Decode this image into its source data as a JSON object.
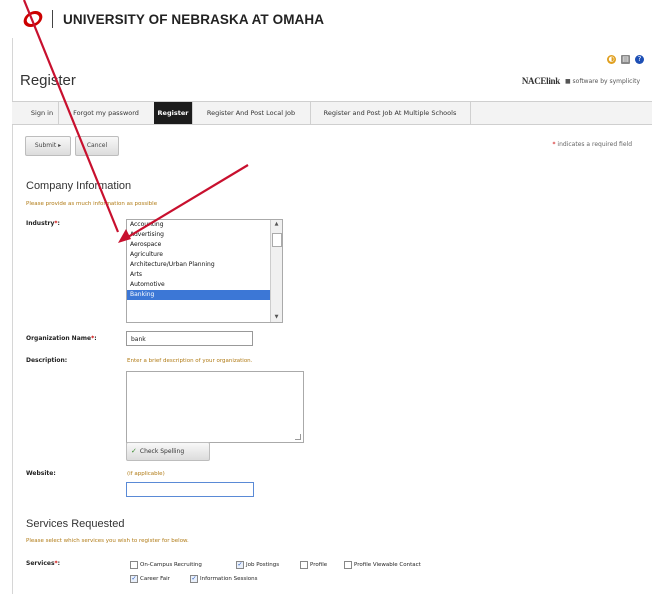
{
  "banner": {
    "university": "UNIVERSITY OF NEBRASKA AT OMAHA"
  },
  "header": {
    "title": "Register",
    "brand_nace": "NACElink",
    "brand_symplicity": "software by symplicity"
  },
  "tabs": [
    {
      "label": "Sign in",
      "active": false
    },
    {
      "label": "Forgot my password",
      "active": false
    },
    {
      "label": "Register",
      "active": true
    },
    {
      "label": "Register And Post Local Job",
      "active": false
    },
    {
      "label": "Register and Post Job At Multiple Schools",
      "active": false
    }
  ],
  "toolbar": {
    "submit_label": "Submit ▸",
    "cancel_label": "Cancel"
  },
  "required_note": {
    "star": "*",
    "text": " indicates a required field"
  },
  "company": {
    "title": "Company Information",
    "subtitle": "Please provide as much information as possible",
    "industry_label": "Industry",
    "industry_options": [
      "Accounting",
      "Advertising",
      "Aerospace",
      "Agriculture",
      "Architecture/Urban Planning",
      "Arts",
      "Automotive",
      "Banking"
    ],
    "industry_selected": "Banking",
    "org_label": "Organization Name",
    "org_value": "bank",
    "desc_label": "Description:",
    "desc_hint": "Enter a brief description of your organization.",
    "spell_label": "Check Spelling",
    "website_label": "Website:",
    "website_hint": "(if applicable)",
    "website_value": ""
  },
  "services": {
    "title": "Services Requested",
    "subtitle": "Please select which services you wish to register for below.",
    "label": "Services",
    "items": [
      {
        "label": "On-Campus Recruiting",
        "checked": false
      },
      {
        "label": "Job Postings",
        "checked": true
      },
      {
        "label": "Profile",
        "checked": false
      },
      {
        "label": "Profile Viewable Contact",
        "checked": false
      },
      {
        "label": "Career Fair",
        "checked": true
      },
      {
        "label": "Information Sessions",
        "checked": true
      }
    ]
  },
  "colors": {
    "accent": "#c8102e",
    "selected": "#3c77d6",
    "hint": "#b07a14"
  }
}
